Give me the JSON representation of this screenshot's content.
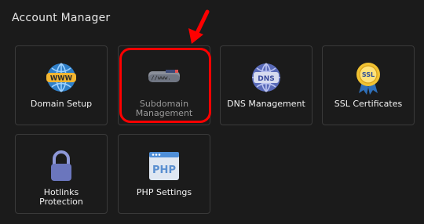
{
  "section": {
    "title": "Account Manager"
  },
  "tiles": [
    {
      "label": "Domain Setup",
      "icon": "www-globe-icon"
    },
    {
      "label": "Subdomain\nManagement",
      "icon": "subdomain-icon",
      "disabled": true
    },
    {
      "label": "DNS Management",
      "icon": "dns-globe-icon"
    },
    {
      "label": "SSL Certificates",
      "icon": "ssl-badge-icon"
    },
    {
      "label": "Hotlinks\nProtection",
      "icon": "lock-icon"
    },
    {
      "label": "PHP Settings",
      "icon": "php-window-icon"
    }
  ],
  "annotation": {
    "color": "#ff0000"
  }
}
